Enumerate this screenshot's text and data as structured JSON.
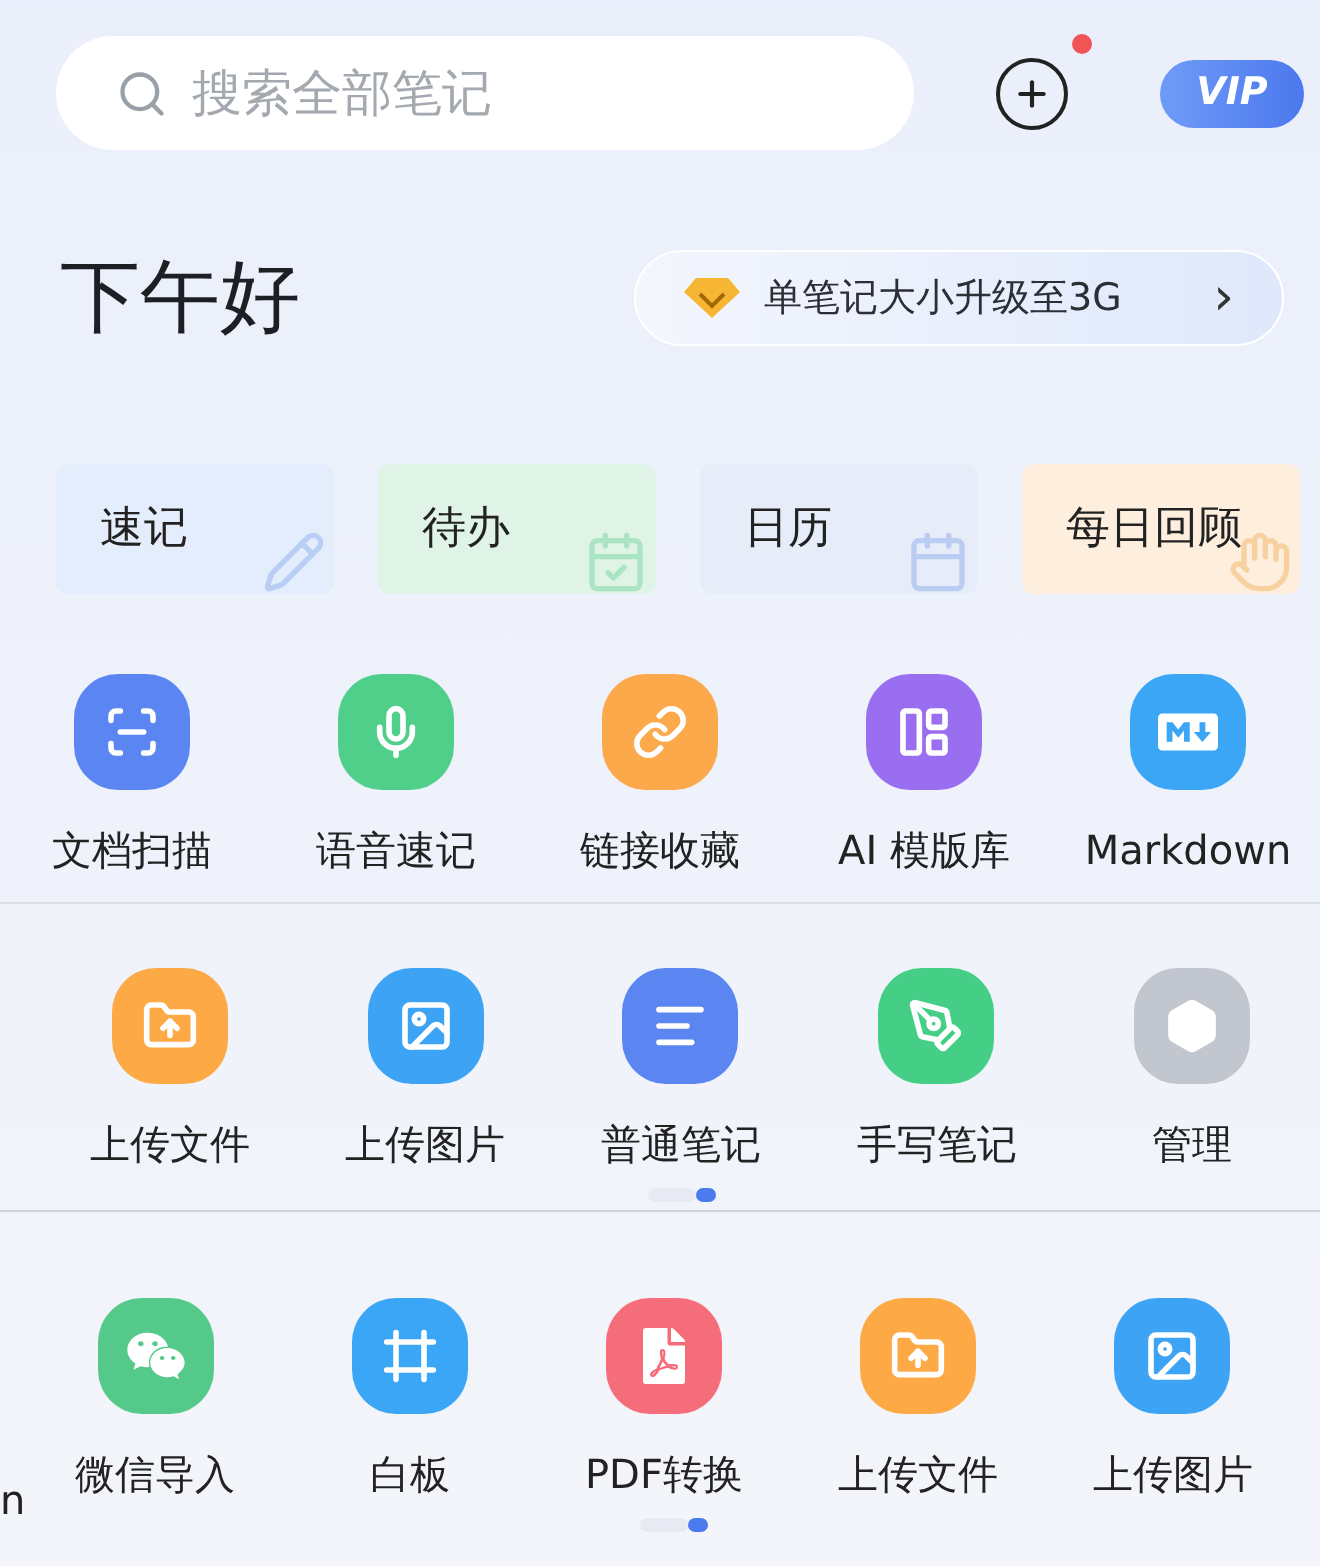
{
  "search": {
    "placeholder": "搜索全部笔记"
  },
  "header": {
    "add_badge": true,
    "vip": "VIP"
  },
  "greeting": "下午好",
  "promo": {
    "text": "单笔记大小升级至3G",
    "arrow": "›"
  },
  "quick_cards": [
    {
      "label": "速记",
      "kind": "pencil",
      "color": "#e3edfb"
    },
    {
      "label": "待办",
      "kind": "todo",
      "color": "#dff3e6"
    },
    {
      "label": "日历",
      "kind": "calendar",
      "color": "#e6edf9"
    },
    {
      "label": "每日回顾",
      "kind": "hand",
      "color": "#fdeedd"
    }
  ],
  "tools": [
    {
      "label": "文档扫描",
      "kind": "scan",
      "color": "#5b86f2"
    },
    {
      "label": "语音速记",
      "kind": "mic",
      "color": "#4fcf8a"
    },
    {
      "label": "链接收藏",
      "kind": "link",
      "color": "#fba94b"
    },
    {
      "label": "AI 模版库",
      "kind": "template",
      "color": "#9a6ef0"
    },
    {
      "label": "Markdown",
      "kind": "markdown",
      "color": "#3aa6f5"
    }
  ],
  "create": {
    "items": [
      {
        "label": "上传文件",
        "kind": "folder",
        "color": "#fdaa46"
      },
      {
        "label": "上传图片",
        "kind": "image",
        "color": "#3da4f5"
      },
      {
        "label": "普通笔记",
        "kind": "note",
        "color": "#5b86f2"
      },
      {
        "label": "手写笔记",
        "kind": "pen",
        "color": "#45cf86"
      },
      {
        "label": "管理",
        "kind": "manage",
        "color": "#c2c6cf"
      }
    ],
    "pages": [
      {
        "selected": false
      },
      {
        "selected": true
      }
    ]
  },
  "more": {
    "cut_text": "n",
    "items": [
      {
        "label": "微信导入",
        "kind": "wechat",
        "color": "#55c98a"
      },
      {
        "label": "白板",
        "kind": "board",
        "color": "#3aa6f5"
      },
      {
        "label": "PDF转换",
        "kind": "pdf",
        "color": "#f56d7a"
      },
      {
        "label": "上传文件",
        "kind": "folder",
        "color": "#fdaa46"
      },
      {
        "label": "上传图片",
        "kind": "image",
        "color": "#3da4f5"
      }
    ],
    "pages": [
      {
        "selected": false
      },
      {
        "selected": true
      }
    ]
  }
}
